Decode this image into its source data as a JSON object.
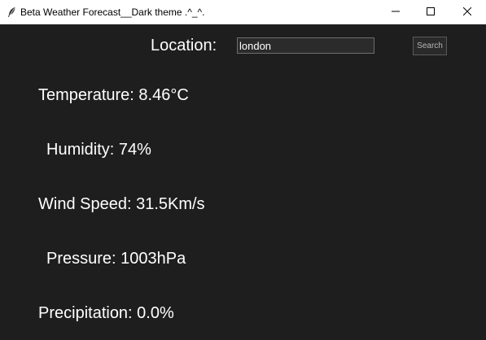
{
  "window": {
    "title": "Beta Weather Forecast__Dark theme .^_^."
  },
  "colors": {
    "background": "#1e1e1e",
    "text": "#ffffff",
    "titlebar": "#ffffff"
  },
  "location": {
    "label": "Location:",
    "value": "london",
    "search_label": "Search"
  },
  "weather": {
    "temperature": "Temperature: 8.46°C",
    "humidity": "Humidity: 74%",
    "wind_speed": "Wind Speed: 31.5Km/s",
    "pressure": "Pressure: 1003hPa",
    "precipitation": "Precipitation: 0.0%"
  }
}
